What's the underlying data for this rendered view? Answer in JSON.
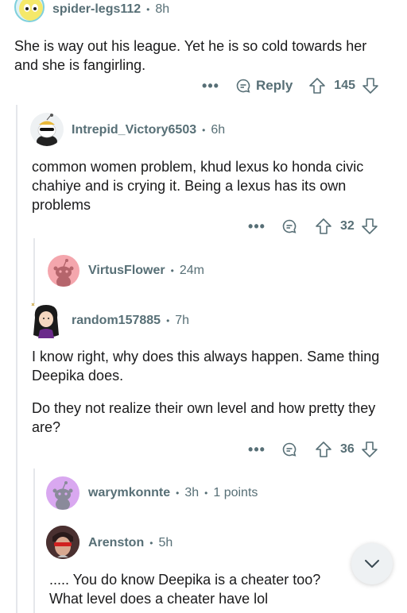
{
  "comments": [
    {
      "username": "spider-legs112",
      "time": "8h",
      "body": "She is way out his league. Yet he is so cold towards her and she is fangirling.",
      "reply_label": "Reply",
      "score": "145"
    },
    {
      "username": "Intrepid_Victory6503",
      "time": "6h",
      "body": "common women problem, khud lexus ko honda civic chahiye and is crying it. Being a lexus has its own problems",
      "score": "32"
    },
    {
      "username": "VirtusFlower",
      "time": "24m"
    },
    {
      "username": "random157885",
      "time": "7h",
      "body_p1": "I know right, why does this always happen. Same thing Deepika does.",
      "body_p2": "Do they not realize their own level and how pretty they are?",
      "score": "36"
    },
    {
      "username": "warymkonnte",
      "time": "3h",
      "points": "1 points"
    },
    {
      "username": "Arenston",
      "time": "5h",
      "body_line1": "..... You do know Deepika is a cheater too?",
      "body_line2": "What level does a cheater have lol"
    }
  ],
  "icons": {
    "more": "more-icon",
    "reply": "reply-icon",
    "upvote": "upvote-icon",
    "downvote": "downvote-icon",
    "scroll": "chevron-down-icon"
  },
  "colors": {
    "meta": "#576f76",
    "thread_line": "#e5e7eb",
    "snoo_pink": "#f4a6ad",
    "snoo_purple": "#d9a8f0"
  }
}
